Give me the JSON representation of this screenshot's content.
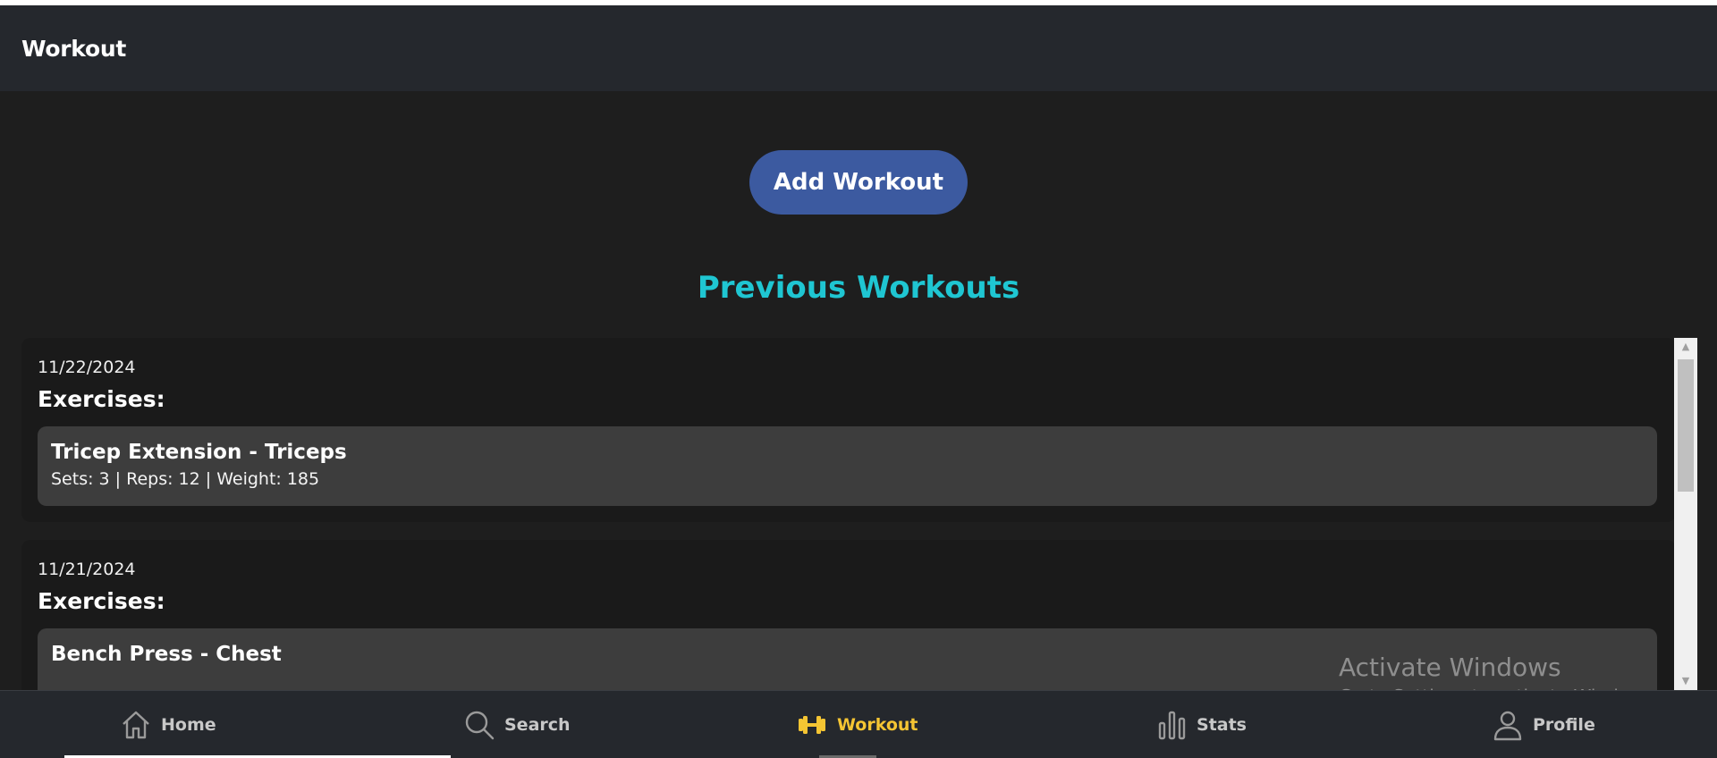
{
  "header": {
    "title": "Workout"
  },
  "actions": {
    "add_workout_label": "Add Workout"
  },
  "section": {
    "title": "Previous Workouts"
  },
  "workouts": [
    {
      "date": "11/22/2024",
      "exercises_label": "Exercises:",
      "exercises": [
        {
          "name": "Tricep Extension - Triceps",
          "detail": "Sets: 3 | Reps: 12 | Weight: 185"
        }
      ]
    },
    {
      "date": "11/21/2024",
      "exercises_label": "Exercises:",
      "exercises": [
        {
          "name": "Bench Press - Chest",
          "detail": ""
        }
      ]
    }
  ],
  "watermark": {
    "title": "Activate Windows",
    "subtitle": "Go to Settings to activate Windows."
  },
  "nav": {
    "items": [
      {
        "label": "Home",
        "icon": "home-icon"
      },
      {
        "label": "Search",
        "icon": "search-icon"
      },
      {
        "label": "Workout",
        "icon": "dumbbell-icon",
        "active": true
      },
      {
        "label": "Stats",
        "icon": "bar-chart-icon"
      },
      {
        "label": "Profile",
        "icon": "user-icon"
      }
    ]
  },
  "colors": {
    "background": "#1e1e1e",
    "header": "#25282d",
    "accent_button": "#3c5aa0",
    "section_title": "#1fc6d2",
    "nav_active": "#f5c533",
    "card": "#1a1a1a",
    "exercise_box": "#3d3d3d"
  }
}
